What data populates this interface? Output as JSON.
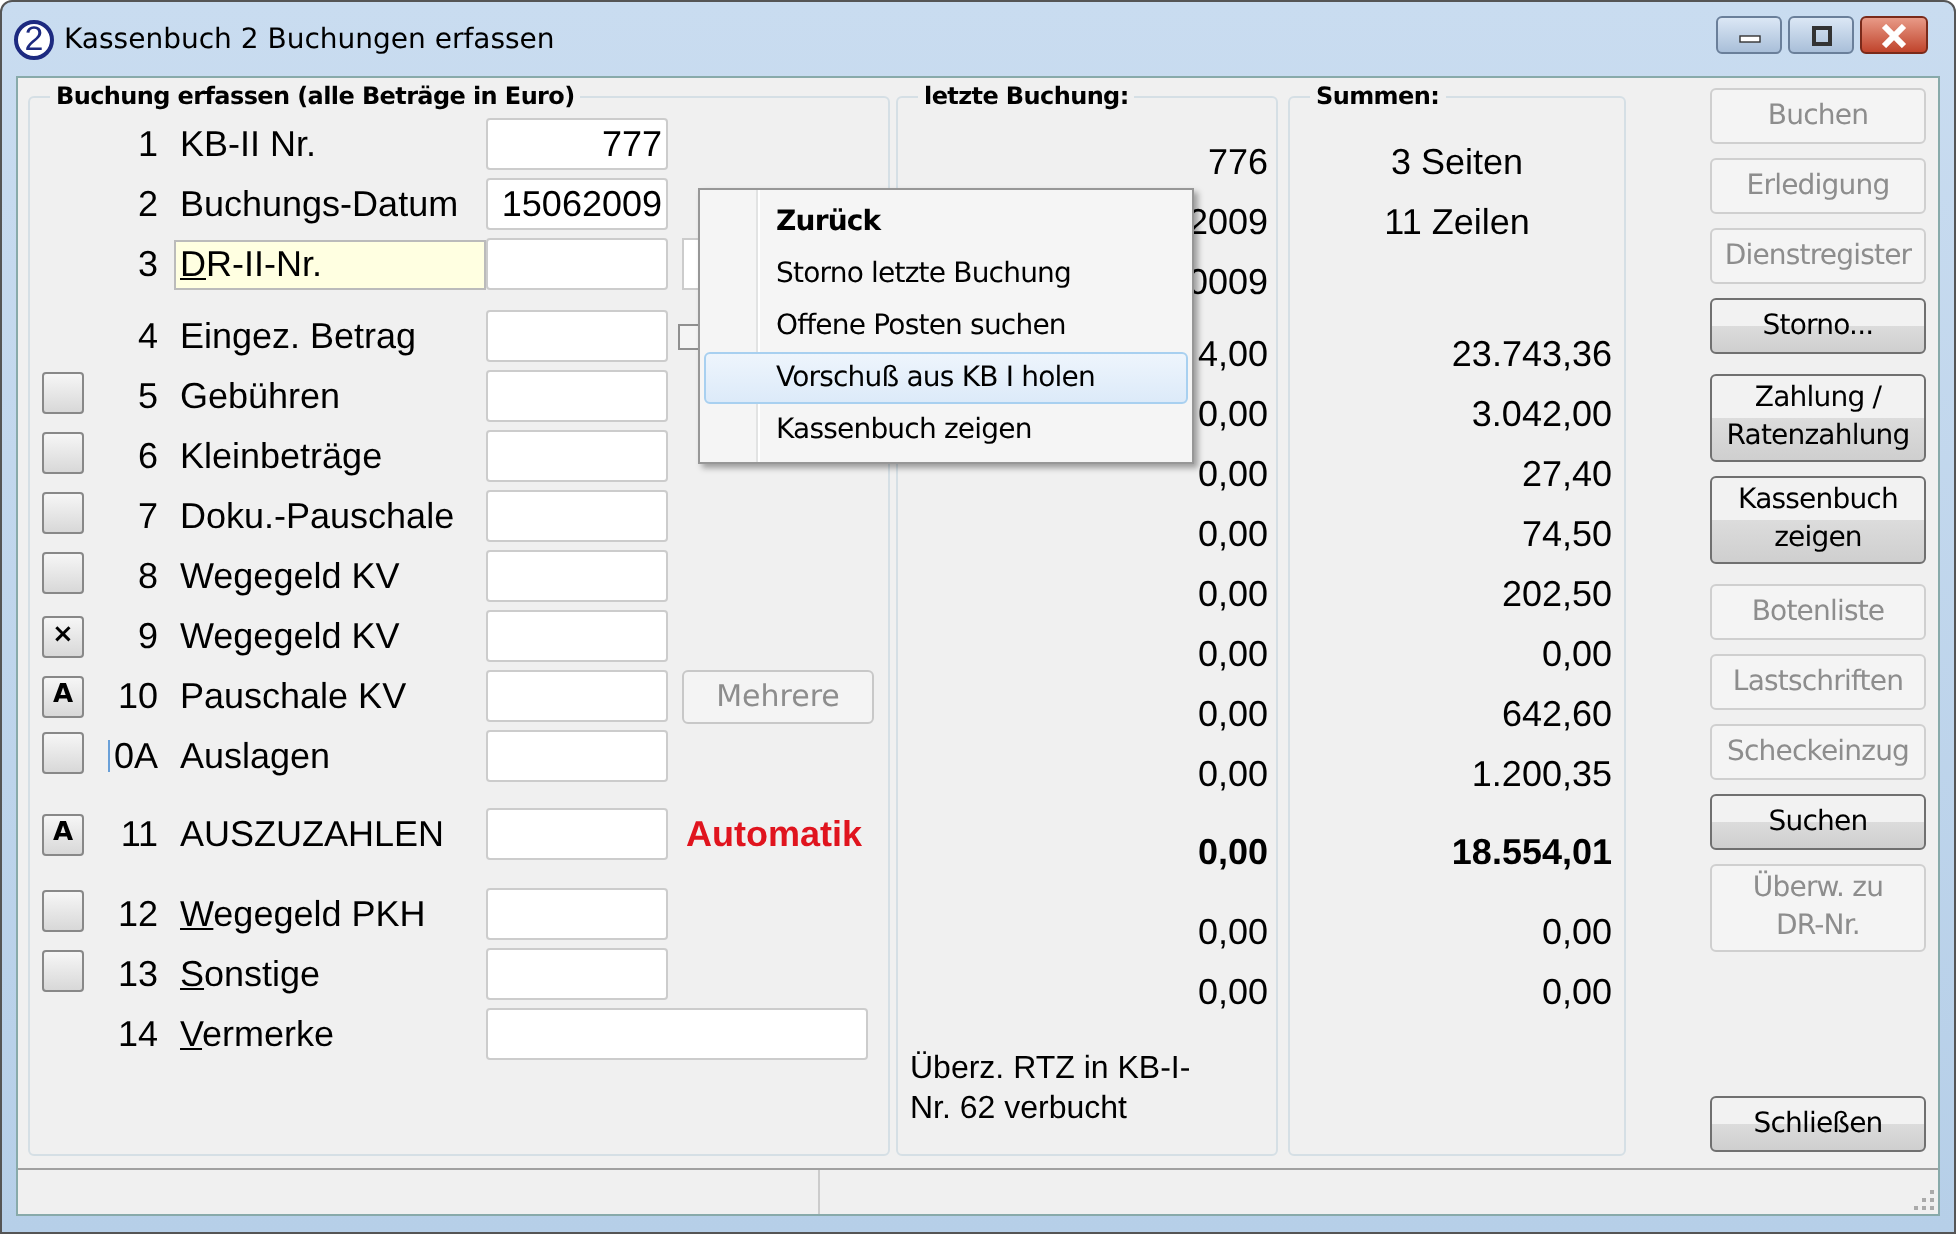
{
  "window": {
    "icon_text": "2",
    "title": "Kassenbuch 2 Buchungen erfassen"
  },
  "form": {
    "title": "Buchung erfassen (alle Beträge in Euro)",
    "rows": [
      {
        "number": "1",
        "label": "KB-II Nr.",
        "value": "777",
        "toggle": false
      },
      {
        "number": "2",
        "label": "Buchungs-Datum",
        "value": "15062009",
        "toggle": false
      },
      {
        "number": "3",
        "label": "DR-II-Nr.",
        "accel": true,
        "focused": true,
        "toggle": false,
        "side_field": true
      },
      {
        "number": "4",
        "label": "Eingez. Betrag",
        "toggle": false,
        "side_checkbox": {
          "checked": false
        }
      },
      {
        "number": "5",
        "label": "Gebühren",
        "toggle": true
      },
      {
        "number": "6",
        "label": "Kleinbeträge",
        "toggle": true
      },
      {
        "number": "7",
        "label": "Doku.-Pauschale",
        "toggle": true
      },
      {
        "number": "8",
        "label": "Wegegeld KV",
        "toggle": true
      },
      {
        "number": "9",
        "label": "Wegegeld KV",
        "toggle": true,
        "toggle_text": "×"
      },
      {
        "number": "10",
        "label": "Pauschale KV",
        "toggle": true,
        "toggle_text": "A",
        "side_button": {
          "label": "Mehrere",
          "disabled": true
        }
      },
      {
        "number": "0A",
        "label": "Auslagen",
        "toggle": true,
        "cursor": true
      },
      {
        "number": "11",
        "label": "AUSZUZAHLEN",
        "toggle": true,
        "toggle_text": "A",
        "side_note": "Automatik"
      },
      {
        "number": "12",
        "label": "Wegegeld PKH",
        "accel": true,
        "toggle": true
      },
      {
        "number": "13",
        "label": "Sonstige",
        "accel": true,
        "toggle": true
      },
      {
        "number": "14",
        "label": "Vermerke",
        "accel": true,
        "toggle": false,
        "wide": true
      }
    ]
  },
  "last_booking": {
    "title": "letzte Buchung:",
    "values": [
      "776",
      "2009",
      "0009",
      "4,00",
      "0,00",
      "0,00",
      "0,00",
      "0,00",
      "0,00",
      "0,00",
      "0,00",
      "0,00",
      "0,00",
      "0,00"
    ],
    "note": "Überz. RTZ in KB-I-Nr. 62 verbucht"
  },
  "sums": {
    "title": "Summen:",
    "pages": "3 Seiten",
    "lines": "11 Zeilen",
    "values": [
      "23.743,36",
      "3.042,00",
      "27,40",
      "74,50",
      "202,50",
      "0,00",
      "642,60",
      "1.200,35",
      "18.554,01",
      "0,00",
      "0,00"
    ]
  },
  "button_groups": [
    [
      {
        "label": "Buchen",
        "disabled": true
      },
      {
        "label": "Erledigung",
        "disabled": true
      },
      {
        "label": "Dienstregister",
        "disabled": true
      },
      {
        "label": "Storno...",
        "disabled": false
      }
    ],
    [
      {
        "label": "Zahlung / Ratenzahlung",
        "disabled": false
      },
      {
        "label": "Kassenbuch zeigen",
        "disabled": false
      }
    ],
    [
      {
        "label": "Botenliste",
        "disabled": true
      },
      {
        "label": "Lastschriften",
        "disabled": true
      },
      {
        "label": "Scheckeinzug",
        "disabled": true
      },
      {
        "label": "Suchen",
        "disabled": false
      },
      {
        "label": "Überw. zu DR-Nr.",
        "disabled": true
      }
    ],
    [
      {
        "label": "Schließen",
        "disabled": false
      }
    ]
  ],
  "context_menu": [
    {
      "label": "Zurück",
      "default": true,
      "selected": false
    },
    {
      "label": "Storno letzte Buchung",
      "default": false,
      "selected": false
    },
    {
      "label": "Offene Posten suchen",
      "default": false,
      "selected": false
    },
    {
      "label": "Vorschuß aus KB I holen",
      "default": false,
      "selected": true
    },
    {
      "label": "Kassenbuch zeigen",
      "default": false,
      "selected": false
    }
  ]
}
